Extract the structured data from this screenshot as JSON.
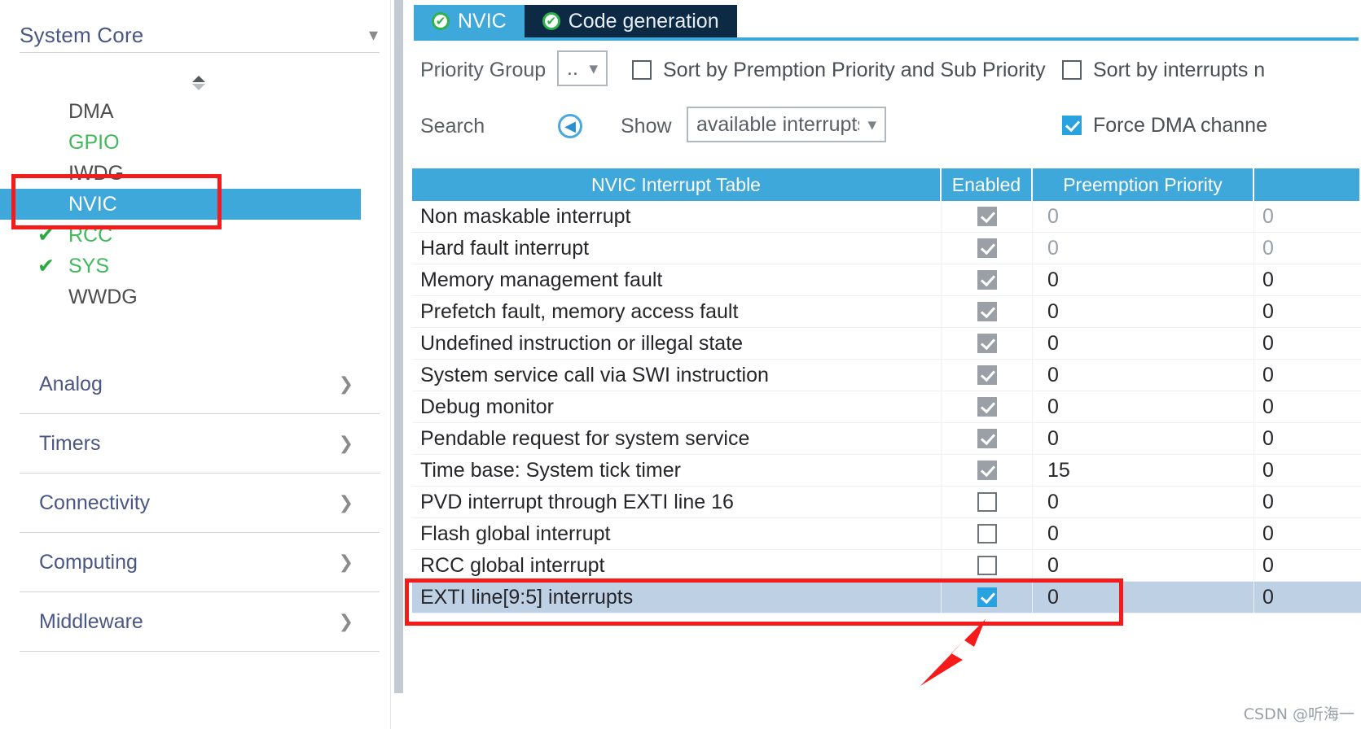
{
  "sidebar": {
    "header": {
      "title": "System Core",
      "chevron": "chevron-down-icon"
    },
    "peripherals": [
      {
        "label": "DMA",
        "state": "normal",
        "check": ""
      },
      {
        "label": "GPIO",
        "state": "green",
        "check": ""
      },
      {
        "label": "IWDG",
        "state": "normal",
        "check": ""
      },
      {
        "label": "NVIC",
        "state": "selected",
        "check": ""
      },
      {
        "label": "RCC",
        "state": "green",
        "check": "✔"
      },
      {
        "label": "SYS",
        "state": "green",
        "check": "✔"
      },
      {
        "label": "WWDG",
        "state": "normal",
        "check": ""
      }
    ],
    "groups": [
      {
        "label": "Analog",
        "chevron": "chevron-right-icon"
      },
      {
        "label": "Timers",
        "chevron": "chevron-right-icon"
      },
      {
        "label": "Connectivity",
        "chevron": "chevron-right-icon"
      },
      {
        "label": "Computing",
        "chevron": "chevron-right-icon"
      },
      {
        "label": "Middleware",
        "chevron": "chevron-right-icon"
      }
    ]
  },
  "tabs": [
    {
      "label": "NVIC",
      "active": true,
      "status_icon": "check-circle-icon"
    },
    {
      "label": "Code generation",
      "active": false,
      "status_icon": "check-circle-icon"
    }
  ],
  "toolbar": {
    "priority_group_label": "Priority Group",
    "priority_group_value": "..",
    "sort_premption_label": "Sort by Premption Priority and Sub Priority",
    "sort_premption_checked": false,
    "sort_interrupts_label": "Sort by interrupts n",
    "sort_interrupts_checked": false,
    "search_label": "Search",
    "search_icon": "circle-left-arrow-icon",
    "show_label": "Show",
    "show_value": "available interrupts",
    "force_dma_label": "Force DMA channe",
    "force_dma_checked": true
  },
  "table": {
    "columns": [
      "NVIC Interrupt Table",
      "Enabled",
      "Preemption Priority",
      ""
    ],
    "rows": [
      {
        "name": "Non maskable interrupt",
        "enabled": "locked",
        "preemption": "0",
        "sub": "0",
        "dim": true,
        "highlight": false
      },
      {
        "name": "Hard fault interrupt",
        "enabled": "locked",
        "preemption": "0",
        "sub": "0",
        "dim": true,
        "highlight": false
      },
      {
        "name": "Memory management fault",
        "enabled": "locked",
        "preemption": "0",
        "sub": "0",
        "dim": false,
        "highlight": false
      },
      {
        "name": "Prefetch fault, memory access fault",
        "enabled": "locked",
        "preemption": "0",
        "sub": "0",
        "dim": false,
        "highlight": false
      },
      {
        "name": "Undefined instruction or illegal state",
        "enabled": "locked",
        "preemption": "0",
        "sub": "0",
        "dim": false,
        "highlight": false
      },
      {
        "name": "System service call via SWI instruction",
        "enabled": "locked",
        "preemption": "0",
        "sub": "0",
        "dim": false,
        "highlight": false
      },
      {
        "name": "Debug monitor",
        "enabled": "locked",
        "preemption": "0",
        "sub": "0",
        "dim": false,
        "highlight": false
      },
      {
        "name": "Pendable request for system service",
        "enabled": "locked",
        "preemption": "0",
        "sub": "0",
        "dim": false,
        "highlight": false
      },
      {
        "name": "Time base: System tick timer",
        "enabled": "locked",
        "preemption": "15",
        "sub": "0",
        "dim": false,
        "highlight": false
      },
      {
        "name": "PVD interrupt through EXTI line 16",
        "enabled": "off",
        "preemption": "0",
        "sub": "0",
        "dim": false,
        "highlight": false
      },
      {
        "name": "Flash global interrupt",
        "enabled": "off",
        "preemption": "0",
        "sub": "0",
        "dim": false,
        "highlight": false
      },
      {
        "name": "RCC global interrupt",
        "enabled": "off",
        "preemption": "0",
        "sub": "0",
        "dim": false,
        "highlight": false
      },
      {
        "name": "EXTI line[9:5] interrupts",
        "enabled": "on",
        "preemption": "0",
        "sub": "0",
        "dim": false,
        "highlight": true
      }
    ]
  },
  "annotations": {
    "box_nvic": "red-highlight-box",
    "box_row": "red-highlight-box",
    "arrow": "red-arrow-icon"
  },
  "watermark": "CSDN @听海一",
  "colors": {
    "accent": "#3fa8db",
    "tab_inactive": "#0d2a44",
    "green": "#41b95a",
    "annotation_red": "#f51b1b",
    "row_highlight": "#bdd0e4"
  }
}
